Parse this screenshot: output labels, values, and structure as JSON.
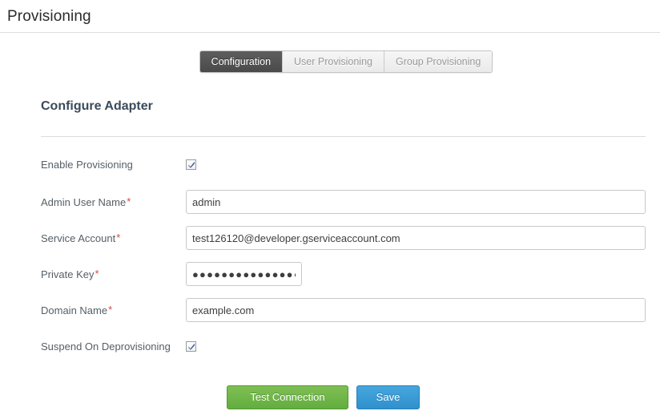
{
  "header": {
    "title": "Provisioning"
  },
  "tabs": [
    {
      "label": "Configuration",
      "active": true
    },
    {
      "label": "User Provisioning",
      "active": false
    },
    {
      "label": "Group Provisioning",
      "active": false
    }
  ],
  "form": {
    "section_title": "Configure Adapter",
    "required_marker": "*",
    "fields": [
      {
        "label": "Enable Provisioning",
        "type": "checkbox",
        "checked": true,
        "required": false
      },
      {
        "label": "Admin User Name",
        "type": "text",
        "value": "admin",
        "placeholder": "",
        "required": true
      },
      {
        "label": "Service Account",
        "type": "text",
        "value": "test126120@developer.gserviceaccount.com",
        "placeholder": "",
        "required": true
      },
      {
        "label": "Private Key",
        "type": "password",
        "value": "●●●●●●●●●●●●●●●●●",
        "placeholder": "",
        "required": true
      },
      {
        "label": "Domain Name",
        "type": "text",
        "value": "example.com",
        "placeholder": "",
        "required": true
      },
      {
        "label": "Suspend On Deprovisioning",
        "type": "checkbox",
        "checked": true,
        "required": false
      }
    ]
  },
  "buttons": {
    "test_connection": "Test Connection",
    "save": "Save"
  },
  "colors": {
    "test_connection_green": "#63ad3f",
    "save_blue": "#2f90cd",
    "required_red": "#d64a3c",
    "active_tab_gray": "#4a4a4a",
    "section_title_slate": "#3b4a5a"
  }
}
